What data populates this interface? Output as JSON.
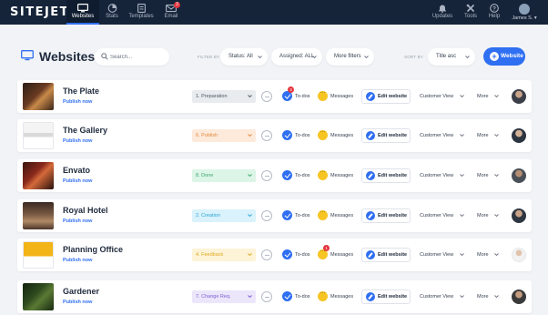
{
  "app": {
    "logo": "SITEJET"
  },
  "nav": [
    {
      "label": "Websites",
      "icon": "monitor-icon",
      "active": true
    },
    {
      "label": "Stats",
      "icon": "stats-icon"
    },
    {
      "label": "Templates",
      "icon": "templates-icon"
    },
    {
      "label": "Email",
      "icon": "email-icon",
      "badge": "3"
    }
  ],
  "right_nav": [
    {
      "label": "Updates",
      "icon": "bell-icon"
    },
    {
      "label": "Tools",
      "icon": "tools-icon"
    },
    {
      "label": "Help",
      "icon": "help-icon"
    }
  ],
  "user": {
    "name": "James S. ▾"
  },
  "toolbar": {
    "title": "Websites",
    "search_placeholder": "Search...",
    "filter_by_label": "FILTER BY",
    "status_filter": "Status: All",
    "assigned_filter": "Assigned: ALL",
    "more_filters": "More filters",
    "sort_by_label": "SORT BY",
    "sort_value": "Title asc",
    "new_button": "Website"
  },
  "row_labels": {
    "todos": "To-dos",
    "messages": "Messages",
    "edit": "Edit website",
    "customer_view": "Customer View",
    "more": "More"
  },
  "rows": [
    {
      "name": "The Plate",
      "publish": "Publish now",
      "status": "1. Preparation",
      "status_bg": "#e9ecef",
      "status_color": "#4b5563",
      "todo_badge": "3",
      "msg_badge": ""
    },
    {
      "name": "The Gallery",
      "publish": "Publish now",
      "status": "6. Publish",
      "status_bg": "#fdeadb",
      "status_color": "#e48a3c",
      "todo_badge": "",
      "msg_badge": ""
    },
    {
      "name": "Envato",
      "publish": "Publish now",
      "status": "8. Done",
      "status_bg": "#dcf5e7",
      "status_color": "#3aa76d",
      "todo_badge": "",
      "msg_badge": ""
    },
    {
      "name": "Royal Hotel",
      "publish": "Publish now",
      "status": "2. Creation",
      "status_bg": "#d9f2fb",
      "status_color": "#2aa6d5",
      "todo_badge": "",
      "msg_badge": ""
    },
    {
      "name": "Planning Office",
      "publish": "Publish now",
      "status": "4. Feedback",
      "status_bg": "#fdf3d6",
      "status_color": "#e0a820",
      "todo_badge": "",
      "msg_badge": "1"
    },
    {
      "name": "Gardener",
      "publish": "Publish now",
      "status": "7. Change Req.",
      "status_bg": "#ece6fb",
      "status_color": "#7b5cd6",
      "todo_badge": "",
      "msg_badge": ""
    }
  ]
}
